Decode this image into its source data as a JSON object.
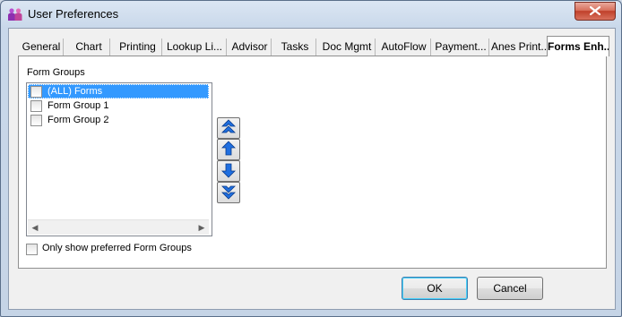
{
  "window": {
    "title": "User Preferences"
  },
  "tabs": [
    {
      "label": "General"
    },
    {
      "label": "Chart"
    },
    {
      "label": "Printing"
    },
    {
      "label": "Lookup Li..."
    },
    {
      "label": "Advisor"
    },
    {
      "label": "Tasks"
    },
    {
      "label": "Doc Mgmt"
    },
    {
      "label": "AutoFlow"
    },
    {
      "label": "Payment..."
    },
    {
      "label": "Anes Print..."
    },
    {
      "label": "Forms Enh..."
    }
  ],
  "active_tab": "Forms Enh...",
  "form_groups": {
    "label": "Form Groups",
    "items": [
      {
        "label": "(ALL) Forms",
        "checked": false,
        "selected": true
      },
      {
        "label": "Form Group 1",
        "checked": false,
        "selected": false
      },
      {
        "label": "Form Group 2",
        "checked": false,
        "selected": false
      }
    ],
    "only_preferred_label": "Only show preferred Form Groups",
    "only_preferred_checked": false
  },
  "buttons": {
    "ok": "OK",
    "cancel": "Cancel"
  },
  "colors": {
    "selection": "#3399ff",
    "close_button": "#c0402a",
    "arrow_blue": "#1f6fe0"
  },
  "icons": {
    "close": "close-icon",
    "move": [
      "move-top-icon",
      "move-up-icon",
      "move-down-icon",
      "move-bottom-icon"
    ]
  }
}
